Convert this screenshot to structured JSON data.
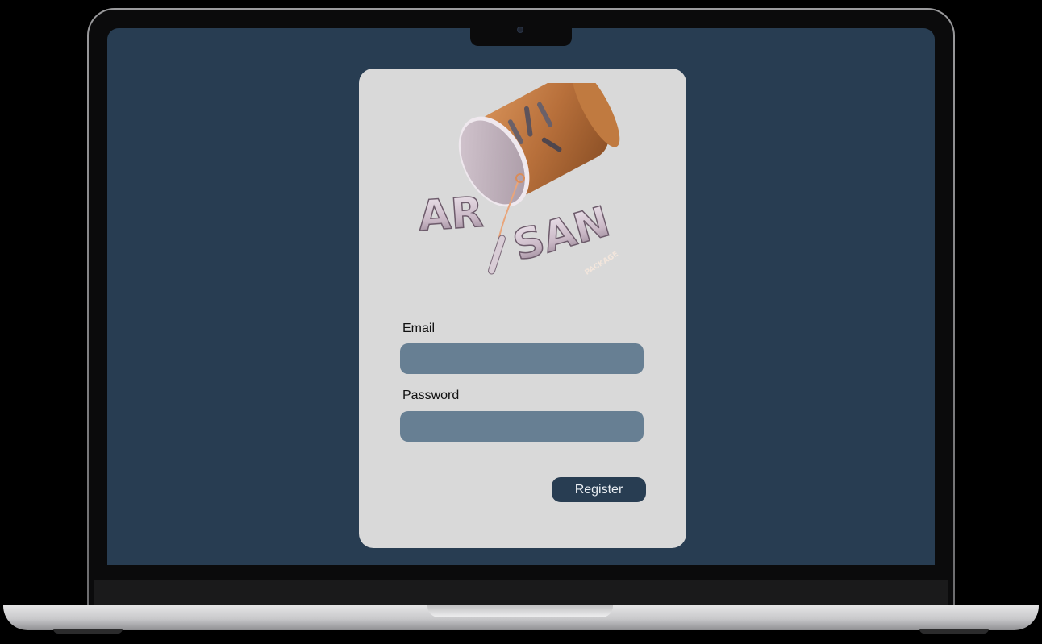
{
  "brand": {
    "logo_text": "ARTISAN",
    "logo_subtext": "PACKAGE"
  },
  "form": {
    "email": {
      "label": "Email",
      "value": "",
      "placeholder": ""
    },
    "password": {
      "label": "Password",
      "value": "",
      "placeholder": ""
    },
    "submit_label": "Register"
  },
  "colors": {
    "screen_bg": "#283d52",
    "card_bg": "#d9d9d9",
    "input_bg": "#677f93",
    "button_bg": "#283d52",
    "button_text": "#e9eef3"
  },
  "icons": {
    "logo": "artisan-package-cup-logo"
  }
}
